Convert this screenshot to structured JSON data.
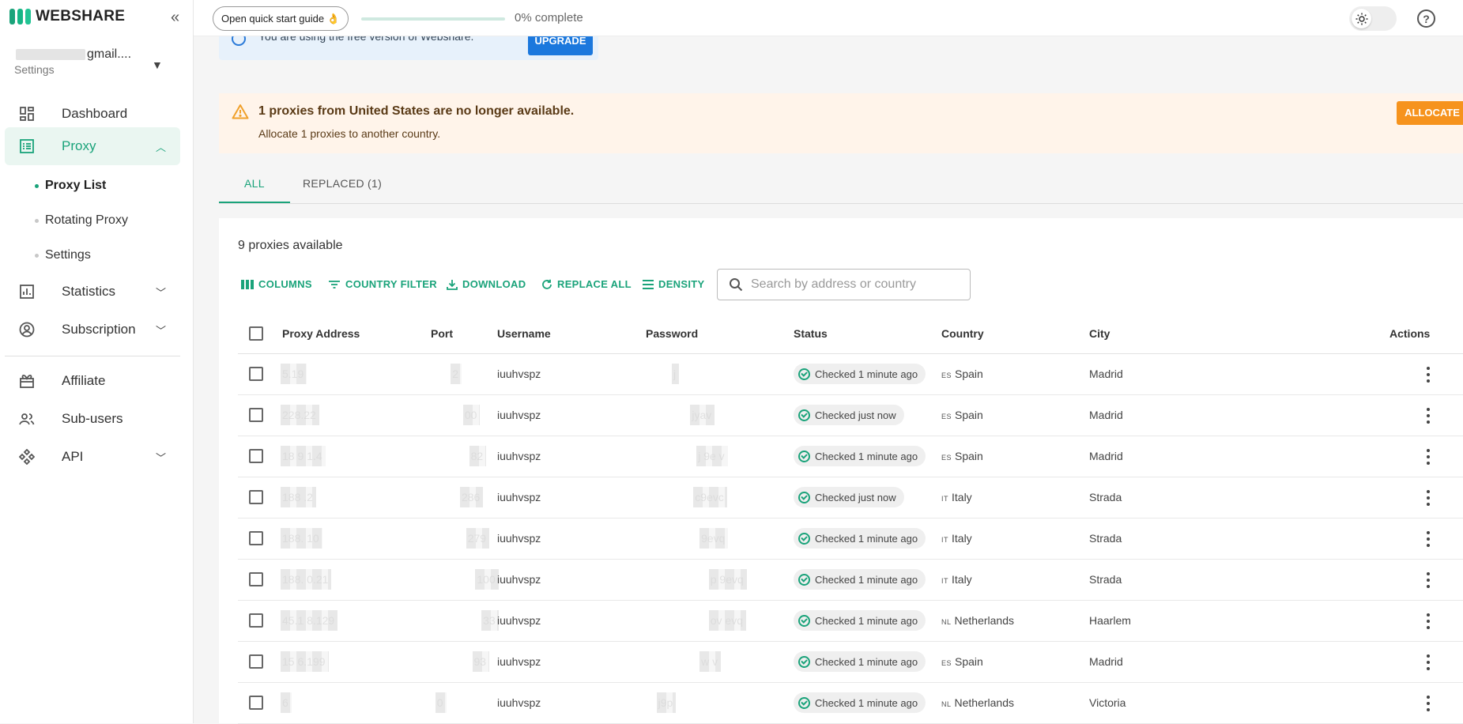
{
  "app": {
    "brand": "WEBSHARE"
  },
  "account": {
    "email_suffix": "gmail....",
    "subtitle": "Settings"
  },
  "sidebar": {
    "items": [
      {
        "label": "Dashboard"
      },
      {
        "label": "Proxy"
      },
      {
        "label": "Statistics"
      },
      {
        "label": "Subscription"
      },
      {
        "label": "Affiliate"
      },
      {
        "label": "Sub-users"
      },
      {
        "label": "API"
      }
    ],
    "proxy_sub": [
      {
        "label": "Proxy List"
      },
      {
        "label": "Rotating Proxy"
      },
      {
        "label": "Settings"
      }
    ]
  },
  "topbar": {
    "guide_label": "Open quick start guide 👌",
    "progress_fraction": 0,
    "progress_label": "0% complete"
  },
  "free_banner": {
    "text": "You are using the free version of Webshare.",
    "button": "UPGRADE"
  },
  "warning": {
    "title": "1 proxies from United States are no longer available.",
    "subtitle": "Allocate 1 proxies to another country.",
    "button": "ALLOCATE"
  },
  "tabs": [
    {
      "label": "ALL"
    },
    {
      "label": "REPLACED (1)"
    }
  ],
  "panel": {
    "available": "9 proxies available",
    "toolbar": {
      "columns": "COLUMNS",
      "country_filter": "COUNTRY FILTER",
      "download": "DOWNLOAD",
      "replace_all": "REPLACE ALL",
      "density": "DENSITY"
    },
    "search_placeholder": "Search by address or country"
  },
  "table": {
    "headers": {
      "address": "Proxy Address",
      "port": "Port",
      "username": "Username",
      "password": "Password",
      "status": "Status",
      "country": "Country",
      "city": "City",
      "actions": "Actions"
    },
    "rows": [
      {
        "address": "5.19",
        "port": "2",
        "username": "iuuhvspz",
        "password": "j",
        "status": "Checked 1 minute ago",
        "cc": "ES",
        "country": "Spain",
        "city": "Madrid"
      },
      {
        "address": "228.22",
        "port": "00",
        "username": "iuuhvspz",
        "password": "jyav",
        "status": "Checked just now",
        "cc": "ES",
        "country": "Spain",
        "city": "Madrid"
      },
      {
        "address": "18 9 1.4",
        "port": "82",
        "username": "iuuhvspz",
        "password": "j 9e v",
        "status": "Checked 1 minute ago",
        "cc": "ES",
        "country": "Spain",
        "city": "Madrid"
      },
      {
        "address": "188 .2",
        "port": "286",
        "username": "iuuhvspz",
        "password": "c9evc",
        "status": "Checked just now",
        "cc": "IT",
        "country": "Italy",
        "city": "Strada"
      },
      {
        "address": "188. 10",
        "port": "279",
        "username": "iuuhvspz",
        "password": "9evq",
        "status": "Checked 1 minute ago",
        "cc": "IT",
        "country": "Italy",
        "city": "Strada"
      },
      {
        "address": "188. 0.21",
        "port": "100",
        "username": "iuuhvspz",
        "password": "p 9evq",
        "status": "Checked 1 minute ago",
        "cc": "IT",
        "country": "Italy",
        "city": "Strada"
      },
      {
        "address": "45.1 8.129",
        "port": "33",
        "username": "iuuhvspz",
        "password": "ov evq",
        "status": "Checked 1 minute ago",
        "cc": "NL",
        "country": "Netherlands",
        "city": "Haarlem"
      },
      {
        "address": "15 6.199",
        "port": "93",
        "username": "iuuhvspz",
        "password": "w v",
        "status": "Checked 1 minute ago",
        "cc": "ES",
        "country": "Spain",
        "city": "Madrid"
      },
      {
        "address": "6",
        "port": "0",
        "username": "iuuhvspz",
        "password": "j9p",
        "status": "Checked 1 minute ago",
        "cc": "NL",
        "country": "Netherlands",
        "city": "Victoria"
      }
    ]
  },
  "colors": {
    "accent": "#1aa37a",
    "warning": "#f6931d",
    "upgrade": "#1b78dd"
  },
  "icons": {
    "collapse": "double-chevron-left-icon",
    "theme": "sun-icon",
    "help": "help-circle-icon"
  }
}
